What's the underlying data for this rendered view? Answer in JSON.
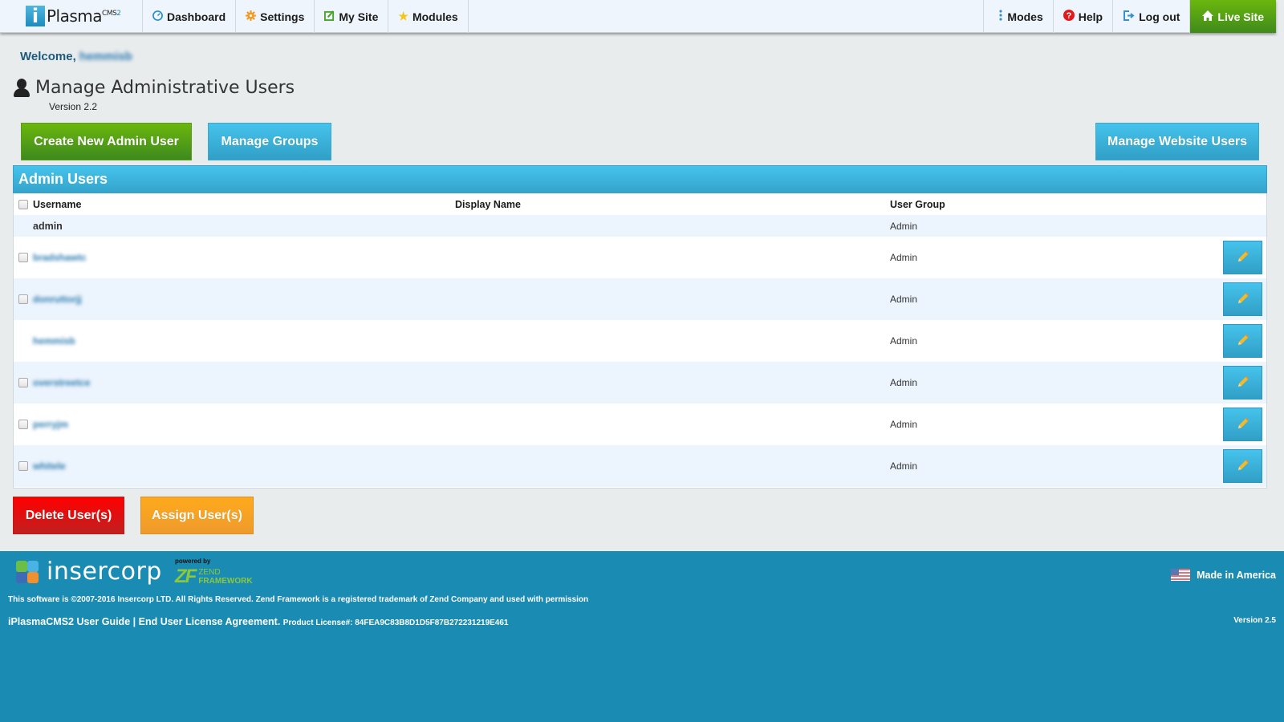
{
  "nav": {
    "logo": {
      "mark": "i",
      "name": "Plasma",
      "sup": "CMS",
      "sup_num": "2"
    },
    "left_items": [
      {
        "label": "Dashboard",
        "icon": "dashboard-icon"
      },
      {
        "label": "Settings",
        "icon": "gear-icon"
      },
      {
        "label": "My Site",
        "icon": "edit-icon"
      },
      {
        "label": "Modules",
        "icon": "star-icon"
      }
    ],
    "right_items": [
      {
        "label": "Modes",
        "icon": "vertical-dots-icon"
      },
      {
        "label": "Help",
        "icon": "help-icon"
      },
      {
        "label": "Log out",
        "icon": "logout-icon"
      },
      {
        "label": "Live Site",
        "icon": "home-icon"
      }
    ]
  },
  "header": {
    "welcome_label": "Welcome,",
    "welcome_user": "hemmisb",
    "title": "Manage Administrative Users",
    "version": "Version 2.2"
  },
  "actions": {
    "create": "Create New Admin User",
    "groups": "Manage Groups",
    "website_users": "Manage Website Users",
    "delete": "Delete User(s)",
    "assign": "Assign User(s)"
  },
  "table": {
    "title": "Admin Users",
    "columns": {
      "username": "Username",
      "display_name": "Display Name",
      "user_group": "User Group"
    },
    "rows": [
      {
        "username": "admin",
        "display_name": "",
        "group": "Admin",
        "checkbox": false,
        "editable": false,
        "blurred": false
      },
      {
        "username": "bradshawtc",
        "display_name": "",
        "group": "Admin",
        "checkbox": true,
        "editable": true,
        "blurred": true
      },
      {
        "username": "donruttorjj",
        "display_name": "",
        "group": "Admin",
        "checkbox": true,
        "editable": true,
        "blurred": true
      },
      {
        "username": "hemmisb",
        "display_name": "",
        "group": "Admin",
        "checkbox": false,
        "editable": true,
        "blurred": true
      },
      {
        "username": "overstreetce",
        "display_name": "",
        "group": "Admin",
        "checkbox": true,
        "editable": true,
        "blurred": true
      },
      {
        "username": "perryjm",
        "display_name": "",
        "group": "Admin",
        "checkbox": true,
        "editable": true,
        "blurred": true
      },
      {
        "username": "whitele",
        "display_name": "",
        "group": "Admin",
        "checkbox": true,
        "editable": true,
        "blurred": true
      }
    ]
  },
  "footer": {
    "brand": "insercorp",
    "powered_by": "powered by",
    "zend_mark": "ZF",
    "zend_line1": "ZEND",
    "zend_line2": "FRAMEWORK",
    "copyright": "This software is ©2007-2016 Insercorp LTD. All Rights Reserved. Zend Framework is a registered trademark of Zend Company and used with permission",
    "user_guide": "iPlasmaCMS2 User Guide",
    "separator": " | ",
    "eula": "End User License Agreement.",
    "license": "Product License#: 84FEA9C83B8D1D5F87B272231219E461",
    "made_in": "Made in America",
    "version": "Version 2.5"
  },
  "colors": {
    "nav_bg": "#eef5fc",
    "green": "#5aa514",
    "blue": "#3bb3df",
    "red": "#e00a0a",
    "orange": "#f7a323",
    "footer_bg": "#1a8bb3"
  }
}
